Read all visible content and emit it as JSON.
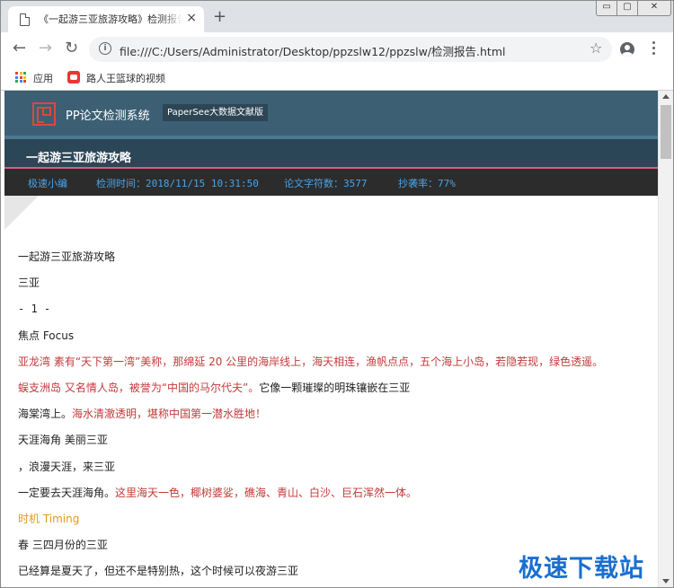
{
  "browser": {
    "tab_title": "《一起游三亚旅游攻略》检测报告",
    "tab_close": "×",
    "new_tab": "+",
    "window_min": "▭",
    "window_max": "▢",
    "window_close": "✕",
    "url": "file:///C:/Users/Administrator/Desktop/ppzslw12/ppzslw/检测报告.html",
    "bookmarks": [
      {
        "label": "应用"
      },
      {
        "label": "路人王篮球的视频"
      }
    ]
  },
  "report": {
    "system_name": "PP论文检测系统",
    "edition": "PaperSee大数据文献版",
    "title": "一起游三亚旅游攻略",
    "meta": {
      "author": "极速小编",
      "time": "检测时间：2018/11/15 10:31:50",
      "chars": "论文字符数：3577",
      "rate": "抄袭率：77%"
    }
  },
  "content_lines": [
    {
      "segments": [
        {
          "text": "一起游三亚旅游攻略",
          "style": "normal"
        }
      ]
    },
    {
      "segments": [
        {
          "text": "三亚",
          "style": "normal"
        }
      ]
    },
    {
      "segments": [
        {
          "text": "- 1 -",
          "style": "mono"
        }
      ]
    },
    {
      "segments": [
        {
          "text": "焦点 Focus",
          "style": "normal"
        }
      ]
    },
    {
      "segments": [
        {
          "text": "亚龙湾 素有“天下第一湾”美称，那绵延 20 公里的海岸线上，海天相连，渔帆点点，五个海上小岛，若隐若现，绿色透遥。",
          "style": "red"
        }
      ]
    },
    {
      "segments": [
        {
          "text": "蜈支洲岛 又名情人岛，被誉为“中国的马尔代夫”。",
          "style": "red"
        },
        {
          "text": "它像一颗璀璨的明珠镶嵌在三亚",
          "style": "normal"
        }
      ]
    },
    {
      "segments": [
        {
          "text": "海棠湾上。",
          "style": "normal"
        },
        {
          "text": "海水清澈透明，堪称中国第一潜水胜地！",
          "style": "red"
        }
      ]
    },
    {
      "segments": [
        {
          "text": "天涯海角 美丽三亚",
          "style": "normal"
        }
      ]
    },
    {
      "segments": [
        {
          "text": "，浪漫天涯，来三亚",
          "style": "normal"
        }
      ]
    },
    {
      "segments": [
        {
          "text": "一定要去天涯海角。",
          "style": "normal"
        },
        {
          "text": "这里海天一色，椰树婆娑，礁海、青山、白沙、巨石浑然一体。",
          "style": "red"
        }
      ]
    },
    {
      "segments": [
        {
          "text": "时机 Timing",
          "style": "orange"
        }
      ]
    },
    {
      "segments": [
        {
          "text": "春 三四月份的三亚",
          "style": "normal"
        }
      ]
    },
    {
      "segments": [
        {
          "text": "已经算是夏天了，但还不是特别热，这个时候可以夜游三亚",
          "style": "normal"
        }
      ]
    }
  ],
  "watermark": "极速下载站",
  "colors": {
    "header_bg": "#3c5f74",
    "title_bg": "#2b4656",
    "meta_bg": "#2c2c2c",
    "meta_text": "#4aa3e8",
    "red_text": "#c23a3a",
    "orange_text": "#e29a1a",
    "accent_line": "#e05a82"
  }
}
